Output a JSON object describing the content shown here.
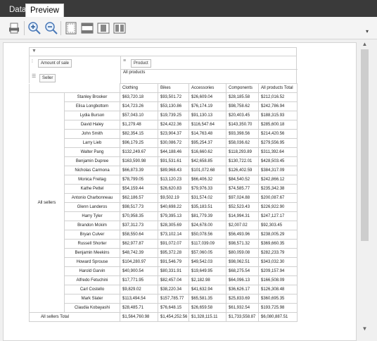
{
  "tabs": [
    {
      "label": "Data",
      "active": false
    },
    {
      "label": "Preview",
      "active": true
    }
  ],
  "toolbar": {
    "buttons": [
      {
        "name": "print-icon"
      },
      {
        "name": "zoom-in-icon"
      },
      {
        "name": "zoom-out-icon"
      },
      {
        "name": "page-setup-icon"
      },
      {
        "name": "page-layout-icon"
      },
      {
        "name": "single-page-icon"
      },
      {
        "name": "two-pages-icon"
      }
    ]
  },
  "pivot": {
    "data_field": "Amount of sale",
    "column_field": "Product",
    "row_field": "Seller",
    "column_group": "All products",
    "columns": [
      "Clothing",
      "Bikes",
      "Accessories",
      "Components"
    ],
    "total_header": "All products Total",
    "row_group": "All sellers",
    "rows": [
      {
        "seller": "Stanley Brooker",
        "values": [
          "$63,720.18",
          "$93,501.72",
          "$26,609.04",
          "$28,185.58",
          "$212,016.52"
        ]
      },
      {
        "seller": "Elisa Longbottom",
        "values": [
          "$14,723.26",
          "$53,130.86",
          "$76,174.19",
          "$98,758.62",
          "$242,786.94"
        ]
      },
      {
        "seller": "Lydia Burson",
        "values": [
          "$57,043.10",
          "$19,739.25",
          "$91,130.13",
          "$20,403.45",
          "$188,315.93"
        ]
      },
      {
        "seller": "David Haley",
        "values": [
          "$1,279.48",
          "$24,422.36",
          "$116,547.64",
          "$143,350.70",
          "$285,600.18"
        ]
      },
      {
        "seller": "John Smith",
        "values": [
          "$82,354.15",
          "$23,904.37",
          "$14,763.48",
          "$93,398.56",
          "$214,420.56"
        ]
      },
      {
        "seller": "Larry Lieb",
        "values": [
          "$96,179.25",
          "$30,086.72",
          "$95,254.37",
          "$58,036.62",
          "$279,556.95"
        ]
      },
      {
        "seller": "Walter Pang",
        "values": [
          "$132,249.67",
          "$44,188.46",
          "$16,660.62",
          "$118,293.89",
          "$311,392.64"
        ]
      },
      {
        "seller": "Benjamin Dupree",
        "values": [
          "$163,590.98",
          "$91,531.61",
          "$42,658.85",
          "$130,722.01",
          "$428,503.45"
        ]
      },
      {
        "seller": "Nicholas Carmona",
        "values": [
          "$66,873.39",
          "$89,968.43",
          "$101,072.68",
          "$126,402.59",
          "$384,317.09"
        ]
      },
      {
        "seller": "Monica Freitag",
        "values": [
          "$78,799.05",
          "$13,120.23",
          "$66,406.32",
          "$84,540.52",
          "$242,866.12"
        ]
      },
      {
        "seller": "Kathe Pettel",
        "values": [
          "$54,159.44",
          "$26,620.83",
          "$79,976.33",
          "$74,585.77",
          "$235,342.38"
        ]
      },
      {
        "seller": "Antonio Charbonneau",
        "values": [
          "$62,186.57",
          "$9,502.19",
          "$31,574.02",
          "$97,024.88",
          "$200,087.67"
        ]
      },
      {
        "seller": "Glenn Landeros",
        "values": [
          "$98,517.73",
          "$40,698.22",
          "$35,183.51",
          "$52,523.43",
          "$226,922.90"
        ]
      },
      {
        "seller": "Harry Tyler",
        "values": [
          "$70,958.35",
          "$79,395.13",
          "$81,779.39",
          "$14,994.31",
          "$247,127.17"
        ]
      },
      {
        "seller": "Brandon Mckim",
        "values": [
          "$37,312.73",
          "$28,305.69",
          "$24,678.00",
          "$2,007.02",
          "$92,303.45"
        ]
      },
      {
        "seller": "Bryan Culver",
        "values": [
          "$58,550.64",
          "$73,102.14",
          "$50,078.56",
          "$56,493.96",
          "$238,005.29"
        ]
      },
      {
        "seller": "Russell Shorter",
        "values": [
          "$62,977.87",
          "$91,072.07",
          "$117,039.09",
          "$98,571.32",
          "$369,660.35"
        ]
      },
      {
        "seller": "Benjamin Meekins",
        "values": [
          "$48,742.39",
          "$95,372.28",
          "$57,060.05",
          "$80,059.08",
          "$282,233.79"
        ]
      },
      {
        "seller": "Howard Sprouse",
        "values": [
          "$104,280.97",
          "$91,546.79",
          "$49,542.03",
          "$98,062.51",
          "$343,032.30"
        ]
      },
      {
        "seller": "Harold Garvin",
        "values": [
          "$40,900.54",
          "$80,331.91",
          "$19,649.95",
          "$68,275.54",
          "$209,157.94"
        ]
      },
      {
        "seller": "Alfredo Fetuchini",
        "values": [
          "$17,771.95",
          "$82,457.04",
          "$2,182.98",
          "$64,096.13",
          "$166,508.09"
        ]
      },
      {
        "seller": "Carl Costello",
        "values": [
          "$9,829.02",
          "$38,220.34",
          "$41,632.94",
          "$36,626.17",
          "$126,308.48"
        ]
      },
      {
        "seller": "Mark Slater",
        "values": [
          "$113,494.54",
          "$157,785.77",
          "$65,581.35",
          "$25,833.69",
          "$360,695.35"
        ]
      },
      {
        "seller": "Claudia Kobayashi",
        "values": [
          "$28,485.71",
          "$76,648.15",
          "$26,659.58",
          "$61,932.54",
          "$193,725.98"
        ]
      }
    ],
    "total_label": "All sellers  Total",
    "totals": [
      "$1,564,760.98",
      "$1,454,252.56",
      "$1,328,115.11",
      "$1,733,558.87",
      "$6,080,887.51"
    ]
  }
}
